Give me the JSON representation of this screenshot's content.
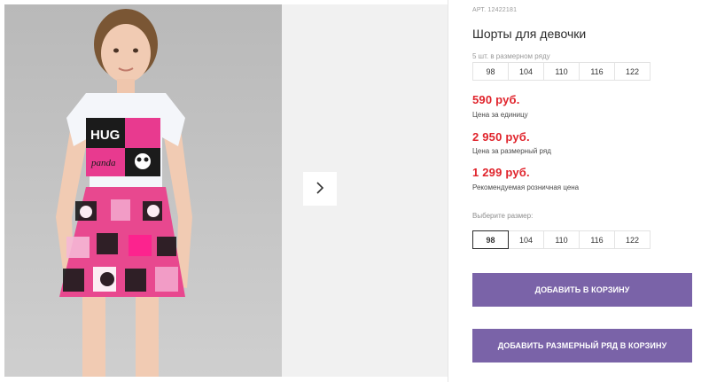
{
  "product": {
    "article": "АРТ. 12422181",
    "title": "Шорты для девочки"
  },
  "pack": {
    "label": "5 шт. в размерном ряду",
    "sizes": [
      "98",
      "104",
      "110",
      "116",
      "122"
    ]
  },
  "prices": {
    "unit_price": "590 руб.",
    "unit_caption": "Цена за единицу",
    "pack_price": "2 950 руб.",
    "pack_caption": "Цена за размерный ряд",
    "retail_price": "1 299 руб.",
    "retail_caption": "Рекомендуемая розничная цена"
  },
  "size_select": {
    "label": "Выберите размер:",
    "selected": "98",
    "sizes": [
      "98",
      "104",
      "110",
      "116",
      "122"
    ]
  },
  "buttons": {
    "add_to_cart": "ДОБАВИТЬ В КОРЗИНУ",
    "add_pack_to_cart": "ДОБАВИТЬ РАЗМЕРНЫЙ РЯД В КОРЗИНУ"
  },
  "icons": {
    "next": "chevron-right-icon"
  },
  "colors": {
    "price": "#e0242c",
    "button": "#7a63a8"
  }
}
